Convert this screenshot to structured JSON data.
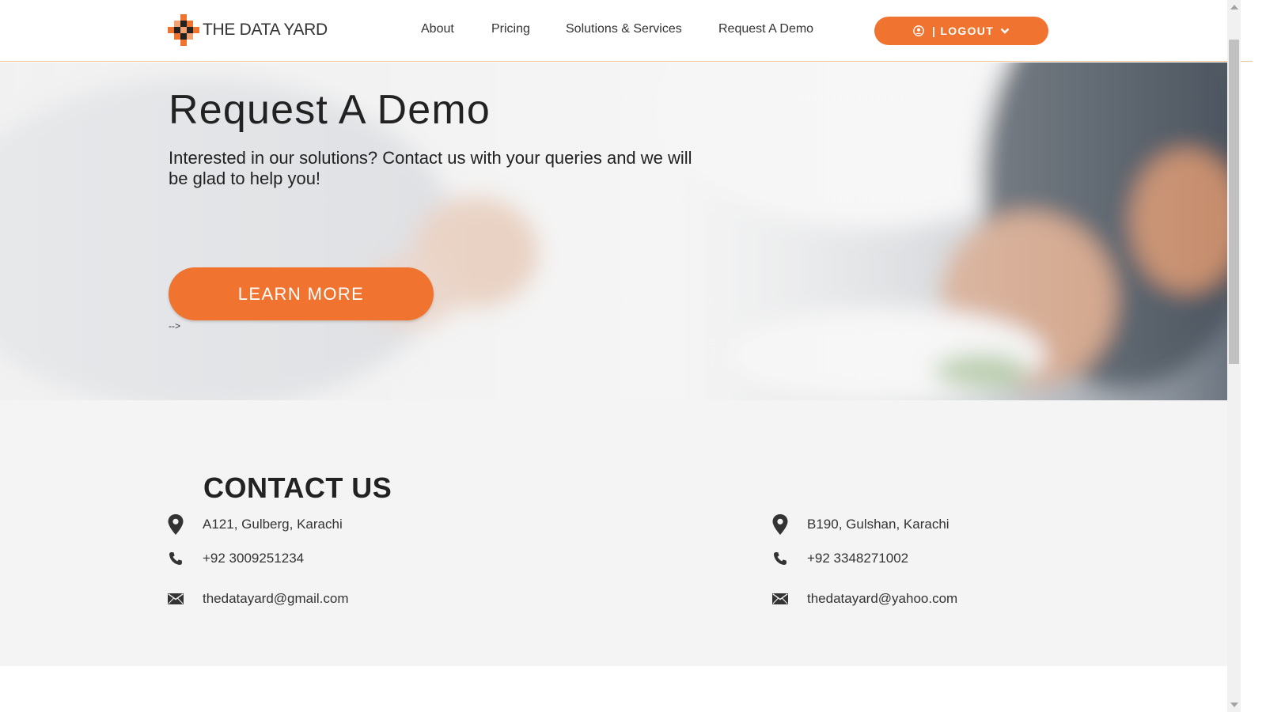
{
  "header": {
    "logo_text": "THE DATA YARD",
    "nav": [
      "About",
      "Pricing",
      "Solutions & Services",
      "Request A Demo"
    ],
    "logout_label": "| LOGOUT"
  },
  "hero": {
    "title": "Request A Demo",
    "subtitle": "Interested in our solutions? Contact us with your queries and we will be glad to help you!",
    "button_label": "LEARN MORE",
    "stray_text": "-->"
  },
  "contact": {
    "title": "CONTACT US",
    "left": {
      "address": "A121, Gulberg, Karachi",
      "phone": "+92 3009251234",
      "email": "thedatayard@gmail.com"
    },
    "right": {
      "address": "B190, Gulshan, Karachi",
      "phone": "+92 3348271002",
      "email": "thedatayard@yahoo.com"
    }
  },
  "colors": {
    "accent": "#f07330",
    "header_border": "#f0c79d",
    "contact_bg": "#f4f4f4"
  },
  "icons": [
    "logo-mark",
    "user-circle-icon",
    "chevron-down-icon",
    "map-pin-icon",
    "phone-icon",
    "envelope-icon"
  ]
}
